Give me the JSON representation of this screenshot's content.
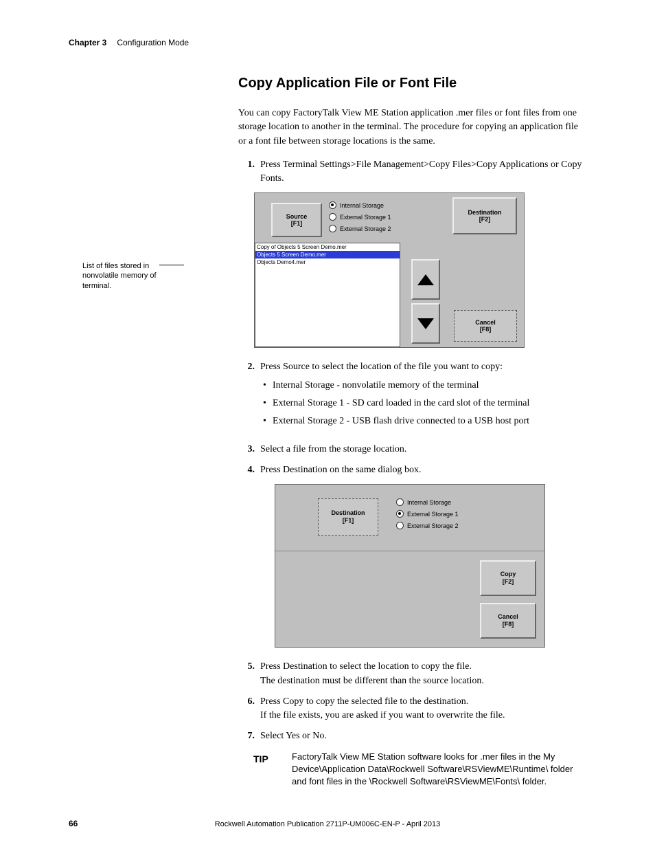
{
  "running_head": {
    "chapter": "Chapter 3",
    "section": "Configuration Mode"
  },
  "heading": "Copy Application File or Font File",
  "intro": "You can copy FactoryTalk View ME Station application .mer files or font files from one storage location to another in the terminal. The procedure for copying an application file or a font file between storage locations is the same.",
  "steps": {
    "s1": "Press Terminal Settings>File Management>Copy Files>Copy Applications or Copy Fonts.",
    "s2": "Press Source to select the location of the file you want to copy:",
    "s2a": "Internal Storage - nonvolatile memory of the terminal",
    "s2b": "External Storage 1 - SD card loaded in the card slot of the terminal",
    "s2c": "External Storage 2 - USB flash drive connected to a USB host port",
    "s3": "Select a file from the storage location.",
    "s4": "Press Destination on the same dialog box.",
    "s5a": "Press Destination to select the location to copy the file.",
    "s5b": "The destination must be different than the source location.",
    "s6a": "Press Copy to copy the selected file to the destination.",
    "s6b": "If the file exists, you are asked if you want to overwrite the file.",
    "s7": "Select Yes or No."
  },
  "side_caption": "List of files stored in nonvolatile memory of terminal.",
  "dlg1": {
    "source_btn": "Source",
    "source_key": "[F1]",
    "dest_btn": "Destination",
    "dest_key": "[F2]",
    "cancel_btn": "Cancel",
    "cancel_key": "[F8]",
    "radios": {
      "r1": "Internal Storage",
      "r2": "External Storage 1",
      "r3": "External Storage 2"
    },
    "files": {
      "f1": "Copy of Objects 5 Screen Demo.mer",
      "f2": "Objects 5 Screen Demo.mer",
      "f3": "Objects Demo4.mer"
    }
  },
  "dlg2": {
    "dest_btn": "Destination",
    "dest_key": "[F1]",
    "copy_btn": "Copy",
    "copy_key": "[F2]",
    "cancel_btn": "Cancel",
    "cancel_key": "[F8]",
    "radios": {
      "r1": "Internal Storage",
      "r2": "External Storage 1",
      "r3": "External Storage 2"
    }
  },
  "tip": {
    "label": "TIP",
    "text": "FactoryTalk View ME Station software looks for .mer files in the My Device\\Application Data\\Rockwell Software\\RSViewME\\Runtime\\ folder and font files in the \\Rockwell Software\\RSViewME\\Fonts\\ folder."
  },
  "footer": "Rockwell Automation Publication 2711P-UM006C-EN-P - April 2013",
  "page_number": "66"
}
